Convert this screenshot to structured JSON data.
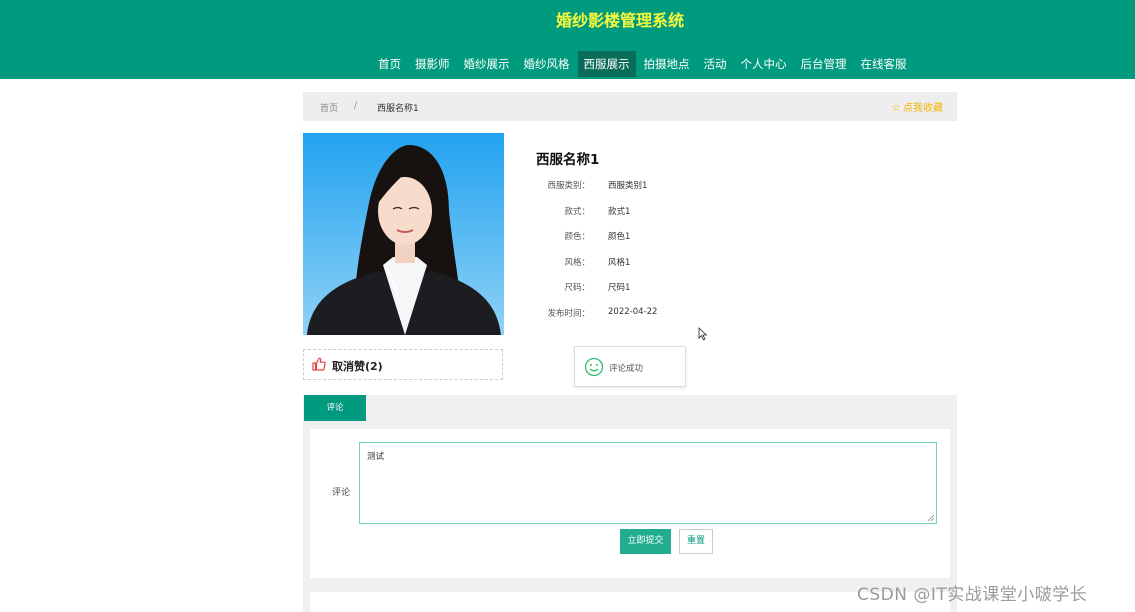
{
  "header": {
    "title": "婚纱影楼管理系统",
    "nav": [
      {
        "label": "首页",
        "active": false
      },
      {
        "label": "摄影师",
        "active": false
      },
      {
        "label": "婚纱展示",
        "active": false
      },
      {
        "label": "婚纱风格",
        "active": false
      },
      {
        "label": "西服展示",
        "active": true
      },
      {
        "label": "拍摄地点",
        "active": false
      },
      {
        "label": "活动",
        "active": false
      },
      {
        "label": "个人中心",
        "active": false
      },
      {
        "label": "后台管理",
        "active": false
      },
      {
        "label": "在线客服",
        "active": false
      }
    ]
  },
  "breadcrumb": {
    "home": "首页",
    "separator": "/",
    "current": "西服名称1",
    "favorite": "点我收藏"
  },
  "product": {
    "name": "西服名称1",
    "fields": [
      {
        "label": "西服类别：",
        "value": "西服类别1"
      },
      {
        "label": "款式：",
        "value": "款式1"
      },
      {
        "label": "颜色：",
        "value": "颜色1"
      },
      {
        "label": "风格：",
        "value": "风格1"
      },
      {
        "label": "尺码：",
        "value": "尺码1"
      },
      {
        "label": "发布时间：",
        "value": "2022-04-22"
      }
    ]
  },
  "like": {
    "label": "取消赞(2)"
  },
  "toast": {
    "message": "评论成功"
  },
  "tabs": [
    {
      "label": "评论"
    }
  ],
  "comment": {
    "label": "评论",
    "value": "测试",
    "submit": "立即提交",
    "reset": "重置"
  },
  "watermark": "CSDN @IT实战课堂小啵学长",
  "colors": {
    "primary": "#009b7e",
    "nav_active": "#0a6d59",
    "title": "#f6f93c",
    "favorite": "#f0b400",
    "submit": "#22ad8f"
  }
}
